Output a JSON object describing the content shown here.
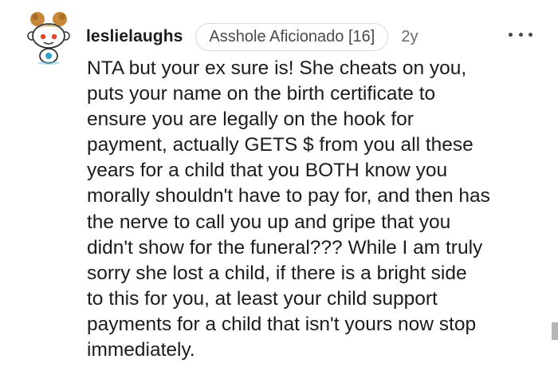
{
  "comment": {
    "username": "leslielaughs",
    "flair": "Asshole Aficionado [16]",
    "age": "2y",
    "avatar_icon": "snoo-avatar-icon",
    "more_icon": "more-options-icon",
    "body_lines": [
      "NTA but your ex sure is! She cheats on you,",
      "puts your name on the birth certificate to",
      "ensure you are legally on the hook for",
      "payment, actually GETS $ from you all these",
      "years for a child that you BOTH know you",
      "morally shouldn't have to pay for, and then has",
      "the nerve to call you up and gripe that you",
      "didn't show for the funeral??? While I am truly",
      "sorry she lost a child, if there is a bright side",
      "to this for you, at least your child support",
      "payments for a child that isn't yours now stop",
      "immediately."
    ]
  },
  "colors": {
    "text": "#1c1c1c",
    "flair_border": "#d8d8d8",
    "muted": "#6b6b6b",
    "avatar_hair": "#c8893a",
    "avatar_accent": "#2fa3c7"
  }
}
